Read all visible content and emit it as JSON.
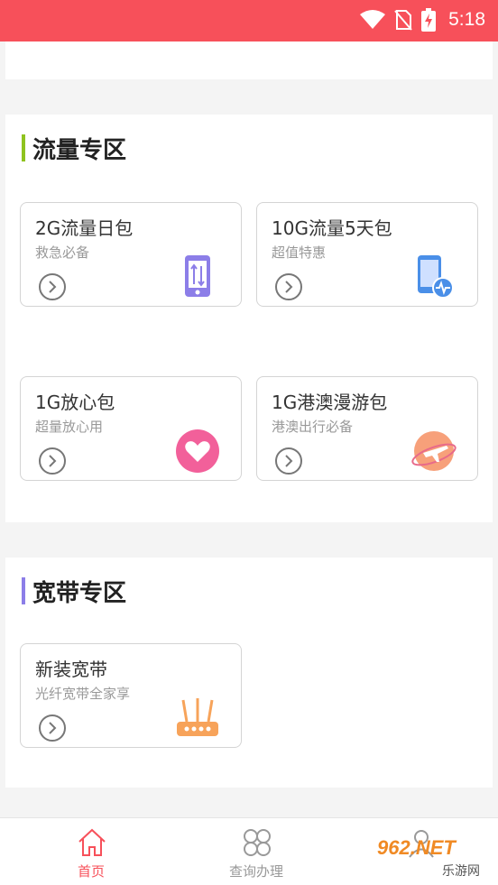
{
  "status_bar": {
    "time": "5:18",
    "color": "#f7505a"
  },
  "sections": [
    {
      "title": "流量专区",
      "accent": "#8fc31f",
      "cards": [
        {
          "title": "2G流量日包",
          "subtitle": "救急必备",
          "icon": "phone-data-icon"
        },
        {
          "title": "10G流量5天包",
          "subtitle": "超值特惠",
          "icon": "phone-signal-icon"
        },
        {
          "title": "1G放心包",
          "subtitle": "超量放心用",
          "icon": "heart-icon"
        },
        {
          "title": "1G港澳漫游包",
          "subtitle": "港澳出行必备",
          "icon": "plane-globe-icon"
        }
      ]
    },
    {
      "title": "宽带专区",
      "accent": "#8c7ee8",
      "cards": [
        {
          "title": "新装宽带",
          "subtitle": "光纤宽带全家享",
          "icon": "router-icon"
        }
      ]
    }
  ],
  "tabs": [
    {
      "label": "首页",
      "icon": "home-icon",
      "active": true,
      "color": "#f7505a"
    },
    {
      "label": "查询办理",
      "icon": "grid-icon",
      "active": false,
      "color": "#999999"
    },
    {
      "label": "",
      "icon": "user-icon",
      "active": false,
      "color": "#999999"
    }
  ],
  "watermark": {
    "text": "962.NET",
    "subtext": "乐游网"
  }
}
